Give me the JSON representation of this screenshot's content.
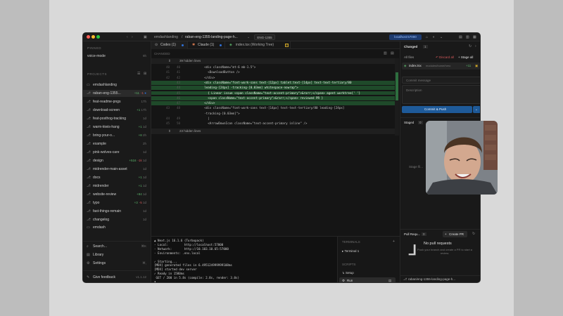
{
  "window": {
    "breadcrumb_repo": "emdashlanding",
    "breadcrumb_sep": "/",
    "breadcrumb_branch": "raban-eng-1355-landing-page-h...",
    "ticket": "ENG-1355",
    "localhost_label": "localhost:57000"
  },
  "sidebar": {
    "pinned_header": "PINNED",
    "pinned_items": [
      {
        "label": "voice-mode",
        "meta": "9h"
      }
    ],
    "projects_header": "PROJECTS",
    "project_name": "emdashlanding",
    "branches": [
      {
        "label": "raban-eng-1355...",
        "add": "+11",
        "del": "-1",
        "meta": ""
      },
      {
        "label": "feat-readme-pngs",
        "add": "",
        "del": "",
        "meta": "17h"
      },
      {
        "label": "download-screen",
        "add": "+1",
        "del": "",
        "meta": "17h"
      },
      {
        "label": "feat-posthog-tracking",
        "add": "",
        "del": "",
        "meta": "1d"
      },
      {
        "label": "warm-kiwis-hang",
        "add": "+1",
        "del": "",
        "meta": "1d"
      },
      {
        "label": "bring-your-o...",
        "add": "+8",
        "del": "",
        "meta": "2h"
      },
      {
        "label": "example",
        "add": "",
        "del": "",
        "meta": "2h"
      },
      {
        "label": "pink-wolves-care",
        "add": "",
        "del": "",
        "meta": "1d"
      },
      {
        "label": "design",
        "add": "+516",
        "del": "-1k",
        "meta": "1d"
      },
      {
        "label": "midrender-main-asset",
        "add": "",
        "del": "",
        "meta": "1d"
      },
      {
        "label": "docs",
        "add": "+1",
        "del": "",
        "meta": "1d"
      },
      {
        "label": "midrender",
        "add": "+1",
        "del": "",
        "meta": "1d"
      },
      {
        "label": "website-review",
        "add": "+84",
        "del": "",
        "meta": "1d"
      },
      {
        "label": "typo",
        "add": "+3",
        "del": "-5",
        "meta": "1d"
      },
      {
        "label": "fast-things-remain",
        "add": "",
        "del": "",
        "meta": "1d"
      },
      {
        "label": "changelog",
        "add": "",
        "del": "",
        "meta": "1d"
      }
    ],
    "second_project": "emdash",
    "search": {
      "label": "Search...",
      "shortcut": "⌘K"
    },
    "library": "Library",
    "settings": {
      "label": "Settings",
      "shortcut": "⌘,"
    },
    "feedback": "Give feedback",
    "version": "v1.1.12"
  },
  "tabs": [
    {
      "label": "Codex (1)"
    },
    {
      "label": "Claude (1)"
    },
    {
      "label": "index.tsx (Working Tree)"
    }
  ],
  "diff": {
    "header": "CHANGED",
    "hidden_top": "39 hidden lines",
    "hidden_bottom": "23 hidden lines",
    "lines": [
      {
        "n1": "40",
        "n2": "40",
        "type": "ctx",
        "text": "          <div className=\"mt-6 mb-1.5\">"
      },
      {
        "n1": "41",
        "n2": "41",
        "type": "ctx",
        "text": "            <DownloadButton />"
      },
      {
        "n1": "42",
        "n2": "42",
        "type": "ctx",
        "text": "          </div>"
      },
      {
        "n1": "",
        "n2": "43",
        "type": "add",
        "text": "          <div className=\"font-work-sans text-[12px] tablet:text-[14px] text-text-tertiary/80"
      },
      {
        "n1": "",
        "n2": "44",
        "type": "add",
        "text": "          leading-[24px] -tracking-[0.03em] whitespace-nowrap\">"
      },
      {
        "n1": "",
        "n2": "45",
        "type": "add",
        "text": "            { Linear issue <span className=\"text-accent-primary\">&rarr;</span> agent worktree{' '}"
      },
      {
        "n1": "",
        "n2": "46",
        "type": "add",
        "text": "            <span className=\"text-accent-primary\">&rarr;</span> reviewed PR }"
      },
      {
        "n1": "",
        "n2": "47",
        "type": "add",
        "text": "          </div>"
      },
      {
        "n1": "43",
        "n2": "48",
        "type": "ctx",
        "text": "          <div className=\"font-work-sans text-[14px] text-text-tertiary/80 leading-[24px]"
      },
      {
        "n1": "",
        "n2": "",
        "type": "ctx",
        "text": "          -tracking-[0.03em]\">"
      },
      {
        "n1": "44",
        "n2": "49",
        "type": "ctx",
        "text": "            |"
      },
      {
        "n1": "45",
        "n2": "50",
        "type": "ctx",
        "text": "            <ArrowDownIcon className=\"text-accent-primary inline\" />"
      }
    ]
  },
  "terminal": {
    "lines": [
      "▲ Next.js 16.1.6 (Turbopack)",
      "- Local:         http://localhost:57000",
      "- Network:       http://10.103.10.65:57000",
      "- Environments: .env.local",
      "",
      "✓ Starting...",
      "[MDX] generated files in 6.495124999999108ms",
      "[MDX] started dev server",
      "✓ Ready in 1580ms",
      " GET / 200 in 5.8s (compile: 2.8s, render: 3.0s)",
      "▮"
    ],
    "terminals_header": "TERMINALS",
    "terminal_item": "Terminal 1",
    "scripts_header": "SCRIPTS",
    "script_setup": "Setup",
    "script_run": "Run"
  },
  "right_panel": {
    "title": "Changed",
    "count": "1",
    "all_files": "All files",
    "discard_all": "Discard all",
    "stage_all": "Stage all",
    "file_name": "index.tsx",
    "file_path": "modules/home/hero",
    "file_delta": "+11",
    "commit_placeholder": "Commit message",
    "description_placeholder": "Description",
    "commit_button": "Commit & Push",
    "staged_label": "Staged",
    "staged_count": "0",
    "stage_hint": "Stage fil...",
    "pr_label": "Pull Requ...",
    "pr_count": "0",
    "create_pr": "Create PR",
    "no_pr_title": "No pull requests",
    "no_pr_sub": "Push your branch and create a PR to start a review.",
    "bottom_branch": "raban/eng-1355-landing-page-h..."
  },
  "colors": {
    "accent": "#2f6fd6",
    "add": "#5bb36a",
    "del": "#d0585a",
    "diff_add_bg": "#1f4a2a"
  }
}
